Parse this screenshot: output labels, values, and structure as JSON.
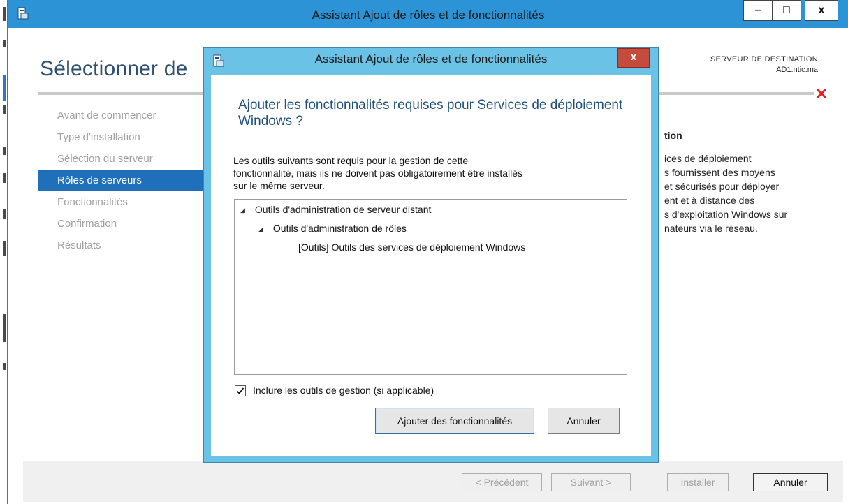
{
  "window": {
    "title": "Assistant Ajout de rôles et de fonctionnalités",
    "controls": {
      "minimize": "–",
      "maximize": "□",
      "close": "x"
    }
  },
  "page": {
    "title": "Sélectionner de",
    "destination_label": "SERVEUR DE DESTINATION",
    "destination_server": "AD1.ntic.ma"
  },
  "nav": [
    {
      "label": "Avant de commencer",
      "selected": false
    },
    {
      "label": "Type d'installation",
      "selected": false
    },
    {
      "label": "Sélection du serveur",
      "selected": false
    },
    {
      "label": "Rôles de serveurs",
      "selected": true
    },
    {
      "label": "Fonctionnalités",
      "selected": false
    },
    {
      "label": "Confirmation",
      "selected": false
    },
    {
      "label": "Résultats",
      "selected": false
    }
  ],
  "description": {
    "heading": "tion",
    "lines": [
      "ices de déploiement",
      "s fournissent des moyens",
      "et sécurisés pour déployer",
      "ent et à distance des",
      "s d'exploitation Windows sur",
      "nateurs via le réseau."
    ]
  },
  "footer": {
    "previous": "< Précédent",
    "next": "Suivant >",
    "install": "Installer",
    "cancel": "Annuler"
  },
  "dialog": {
    "title": "Assistant Ajout de rôles et de fonctionnalités",
    "close": "x",
    "heading": "Ajouter les fonctionnalités requises pour Services de déploiement Windows ?",
    "text_lines": [
      "Les outils suivants sont requis pour la gestion de cette",
      "fonctionnalité, mais ils ne doivent pas obligatoirement être installés",
      "sur le même serveur."
    ],
    "tree": {
      "level1": "Outils d'administration de serveur distant",
      "level2": "Outils d'administration de rôles",
      "level3": "[Outils] Outils des services de déploiement Windows"
    },
    "checkbox_label": "Inclure les outils de gestion (si applicable)",
    "checkbox_checked": true,
    "add_button": "Ajouter des fonctionnalités",
    "cancel_button": "Annuler"
  },
  "colors": {
    "titlebar": "#2b93d6",
    "dialog_frame": "#6ac2e6",
    "selected_nav": "#1f6fbb",
    "heading_blue": "#1e4f7e",
    "error_red": "#e02020"
  }
}
